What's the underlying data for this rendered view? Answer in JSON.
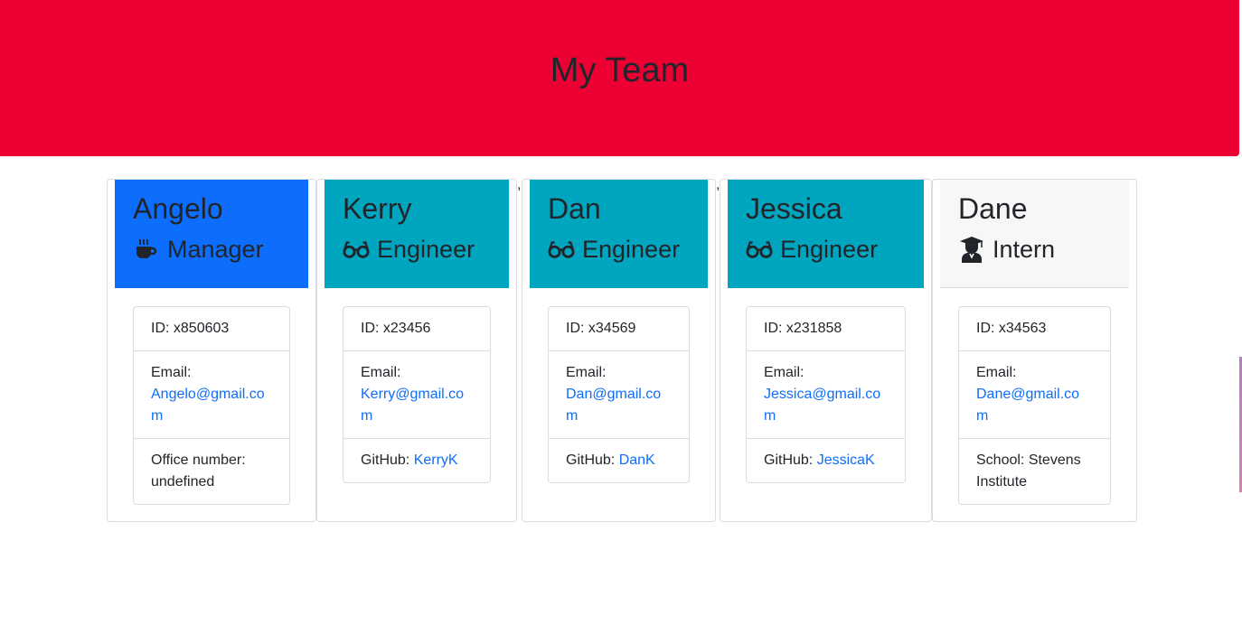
{
  "header": {
    "title": "My Team",
    "background": "#ec0034"
  },
  "separators": [
    ",",
    ","
  ],
  "labels": {
    "id_prefix": "ID: ",
    "email_label": "Email:",
    "office_label": "Office number: ",
    "github_label": "GitHub: ",
    "school_label": "School: "
  },
  "members": [
    {
      "name": "Angelo",
      "role": "Manager",
      "icon": "coffee-icon",
      "color": "#0d6efd",
      "id": "x850603",
      "email_line1": "Angelo@gmail.co",
      "email_line2": "m",
      "extra": "Office number: undefined"
    },
    {
      "name": "Kerry",
      "role": "Engineer",
      "icon": "glasses-icon",
      "color": "#00a5bf",
      "id": "x23456",
      "email_line1": "Kerry@gmail.co",
      "email_line2": "m",
      "github": "KerryK"
    },
    {
      "name": "Dan",
      "role": "Engineer",
      "icon": "glasses-icon",
      "color": "#00a5bf",
      "id": "x34569",
      "email_line1": "Dan@gmail.co",
      "email_line2": "m",
      "github": "DanK"
    },
    {
      "name": "Jessica",
      "role": "Engineer",
      "icon": "glasses-icon",
      "color": "#00a5bf",
      "id": "x231858",
      "email_line1": "Jessica@gmail.co",
      "email_line2": "m",
      "github": "JessicaK"
    },
    {
      "name": "Dane",
      "role": "Intern",
      "icon": "graduate-icon",
      "color": "#f7f7f7",
      "id": "x34563",
      "email_line1": "Dane@gmail.co",
      "email_line2": "m",
      "extra": "School: Stevens Institute"
    }
  ]
}
